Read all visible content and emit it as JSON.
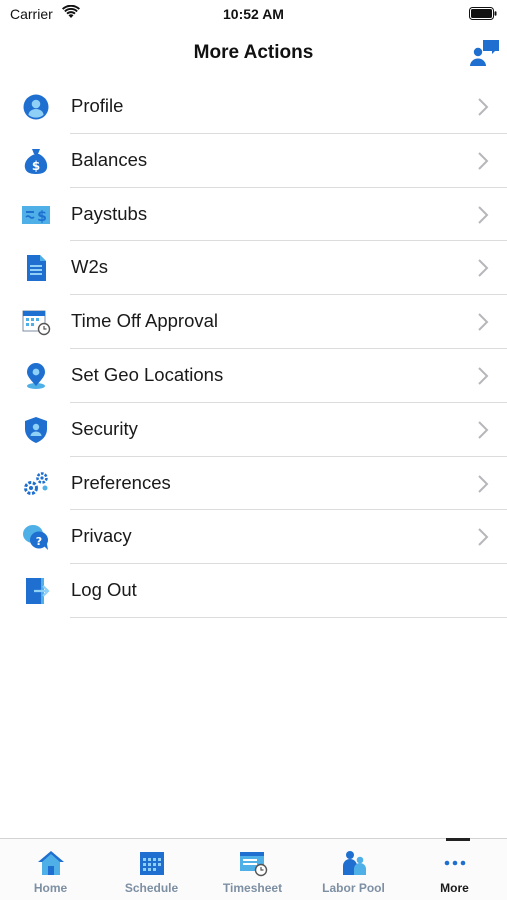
{
  "status": {
    "carrier": "Carrier",
    "time": "10:52 AM"
  },
  "header": {
    "title": "More Actions"
  },
  "items": [
    {
      "label": "Profile",
      "icon": "profile-icon",
      "chevron": true
    },
    {
      "label": "Balances",
      "icon": "money-bag-icon",
      "chevron": true
    },
    {
      "label": "Paystubs",
      "icon": "paystub-icon",
      "chevron": true
    },
    {
      "label": "W2s",
      "icon": "document-icon",
      "chevron": true
    },
    {
      "label": "Time Off Approval",
      "icon": "calendar-clock-icon",
      "chevron": true
    },
    {
      "label": "Set Geo Locations",
      "icon": "location-pin-icon",
      "chevron": true
    },
    {
      "label": "Security",
      "icon": "shield-icon",
      "chevron": true
    },
    {
      "label": "Preferences",
      "icon": "gears-icon",
      "chevron": true
    },
    {
      "label": "Privacy",
      "icon": "privacy-question-icon",
      "chevron": true
    },
    {
      "label": "Log Out",
      "icon": "log-out-icon",
      "chevron": false
    }
  ],
  "tabs": [
    {
      "label": "Home",
      "icon": "home-icon"
    },
    {
      "label": "Schedule",
      "icon": "calendar-icon"
    },
    {
      "label": "Timesheet",
      "icon": "timesheet-icon"
    },
    {
      "label": "Labor Pool",
      "icon": "people-icon"
    },
    {
      "label": "More",
      "icon": "more-dots-icon",
      "active": true
    }
  ],
  "colors": {
    "accent": "#1e6fd0",
    "light_accent": "#4fb0e8",
    "tab_inactive": "#7d8fa3"
  }
}
